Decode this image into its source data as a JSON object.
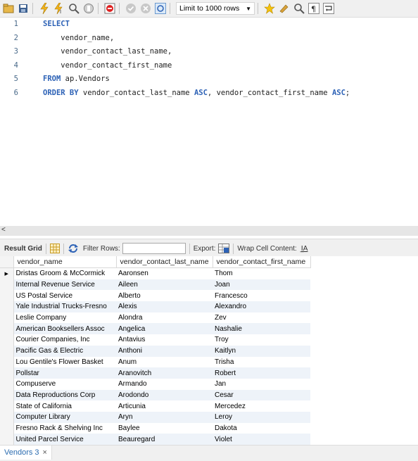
{
  "toolbar": {
    "limit_label": "Limit to 1000 rows"
  },
  "editor": {
    "lines": [
      {
        "n": "1",
        "parts": [
          {
            "t": "SELECT",
            "k": true
          }
        ]
      },
      {
        "n": "2",
        "parts": [
          {
            "t": "    vendor_name,",
            "k": false
          }
        ]
      },
      {
        "n": "3",
        "parts": [
          {
            "t": "    vendor_contact_last_name,",
            "k": false
          }
        ]
      },
      {
        "n": "4",
        "parts": [
          {
            "t": "    vendor_contact_first_name",
            "k": false
          }
        ]
      },
      {
        "n": "5",
        "parts": [
          {
            "t": "FROM",
            "k": true
          },
          {
            "t": " ap.Vendors",
            "k": false
          }
        ]
      },
      {
        "n": "6",
        "parts": [
          {
            "t": "ORDER BY",
            "k": true
          },
          {
            "t": " vendor_contact_last_name ",
            "k": false
          },
          {
            "t": "ASC",
            "k": true
          },
          {
            "t": ", vendor_contact_first_name ",
            "k": false
          },
          {
            "t": "ASC",
            "k": true
          },
          {
            "t": ";",
            "k": false
          }
        ]
      }
    ]
  },
  "result_toolbar": {
    "result_grid": "Result Grid",
    "filter_rows": "Filter Rows:",
    "export": "Export:",
    "wrap": "Wrap Cell Content:"
  },
  "grid": {
    "columns": [
      "vendor_name",
      "vendor_contact_last_name",
      "vendor_contact_first_name"
    ],
    "rows": [
      [
        "Dristas Groom & McCormick",
        "Aaronsen",
        "Thom"
      ],
      [
        "Internal Revenue Service",
        "Aileen",
        "Joan"
      ],
      [
        "US Postal Service",
        "Alberto",
        "Francesco"
      ],
      [
        "Yale Industrial Trucks-Fresno",
        "Alexis",
        "Alexandro"
      ],
      [
        "Leslie Company",
        "Alondra",
        "Zev"
      ],
      [
        "American Booksellers Assoc",
        "Angelica",
        "Nashalie"
      ],
      [
        "Courier Companies, Inc",
        "Antavius",
        "Troy"
      ],
      [
        "Pacific Gas & Electric",
        "Anthoni",
        "Kaitlyn"
      ],
      [
        "Lou Gentile's Flower Basket",
        "Anum",
        "Trisha"
      ],
      [
        "Pollstar",
        "Aranovitch",
        "Robert"
      ],
      [
        "Compuserve",
        "Armando",
        "Jan"
      ],
      [
        "Data Reproductions Corp",
        "Arodondo",
        "Cesar"
      ],
      [
        "State of California",
        "Articunia",
        "Mercedez"
      ],
      [
        "Computer Library",
        "Aryn",
        "Leroy"
      ],
      [
        "Fresno Rack & Shelving Inc",
        "Baylee",
        "Dakota"
      ],
      [
        "United Parcel Service",
        "Beauregard",
        "Violet"
      ]
    ]
  },
  "bottom_tab": {
    "label": "Vendors 3",
    "close": "×"
  },
  "scroll": {
    "left_arrow": "<"
  }
}
